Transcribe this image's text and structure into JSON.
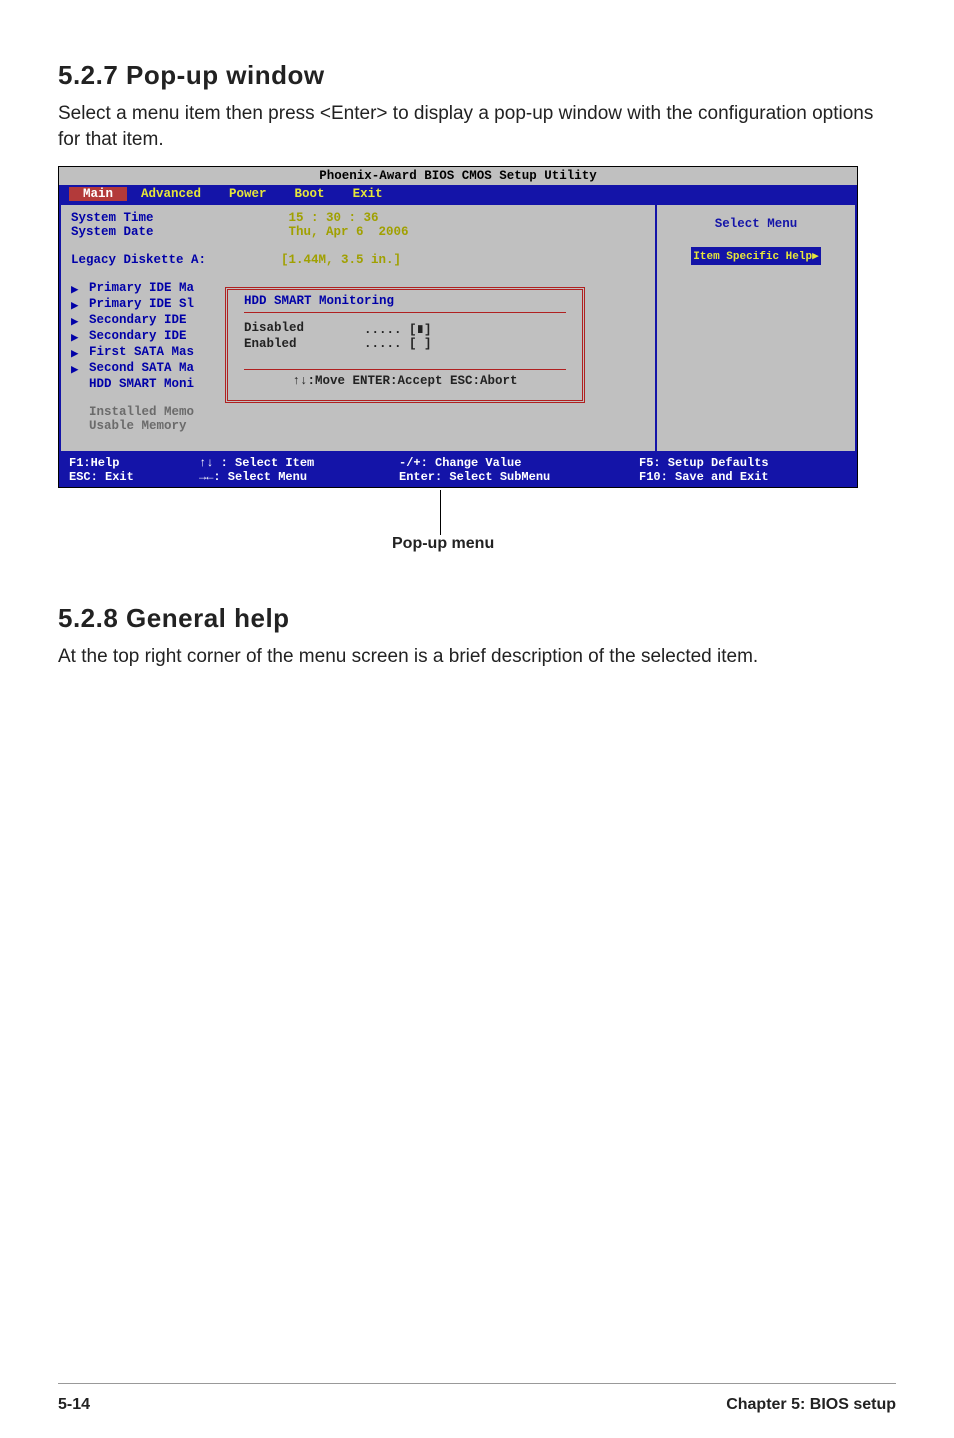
{
  "section527": {
    "heading": "5.2.7  Pop-up window",
    "para": "Select a menu item then press <Enter> to display a pop-up window with the configuration options for that item."
  },
  "bios": {
    "title": "Phoenix-Award BIOS CMOS Setup Utility",
    "menus": {
      "main": "Main",
      "advanced": "Advanced",
      "power": "Power",
      "boot": "Boot",
      "exit": "Exit"
    },
    "left": {
      "systime_l": "System Time",
      "systime_v": " 15 : 30 : 36",
      "sysdate_l": "System Date",
      "sysdate_v": " Thu, Apr 6  2006",
      "legacy_l": "Legacy Diskette A:",
      "legacy_v": "[1.44M, 3.5 in.]",
      "items": [
        "Primary IDE Ma",
        "Primary IDE Sl",
        "Secondary IDE",
        "Secondary IDE",
        "First SATA Mas",
        "Second SATA Ma",
        "HDD SMART Moni",
        "",
        "Installed Memo",
        "Usable Memory"
      ]
    },
    "right": {
      "select": "Select Menu",
      "tip": "Item Specific Help▶"
    },
    "popup": {
      "title": "HDD SMART Monitoring",
      "opt1_l": "Disabled",
      "opt1_v": "..... [∎]",
      "opt2_l": "Enabled",
      "opt2_v": "..... [ ]",
      "foot": "↑↓:Move  ENTER:Accept  ESC:Abort"
    },
    "foot": {
      "r1c1": "F1:Help",
      "r1c2": "↑↓ : Select Item",
      "r1c3": "-/+: Change Value",
      "r1c4": "F5: Setup Defaults",
      "r2c1": "ESC: Exit",
      "r2c2": "→←: Select Menu",
      "r2c3": "Enter: Select SubMenu",
      "r2c4": "F10: Save and Exit"
    }
  },
  "callout": "Pop-up menu",
  "section528": {
    "heading": "5.2.8  General help",
    "para": "At the top right corner of the menu screen is a brief description of the selected item."
  },
  "footer": {
    "left": "5-14",
    "right": "Chapter 5: BIOS setup"
  },
  "chart_data": {
    "type": "table",
    "title": "BIOS Main screen settings",
    "rows": [
      {
        "setting": "System Time",
        "value": "15 : 30 : 36"
      },
      {
        "setting": "System Date",
        "value": "Thu, Apr 6 2006"
      },
      {
        "setting": "Legacy Diskette A:",
        "value": "[1.44M, 3.5 in.]"
      },
      {
        "setting": "HDD SMART Monitoring (pop-up)",
        "value": "Disabled [selected] / Enabled"
      }
    ]
  }
}
